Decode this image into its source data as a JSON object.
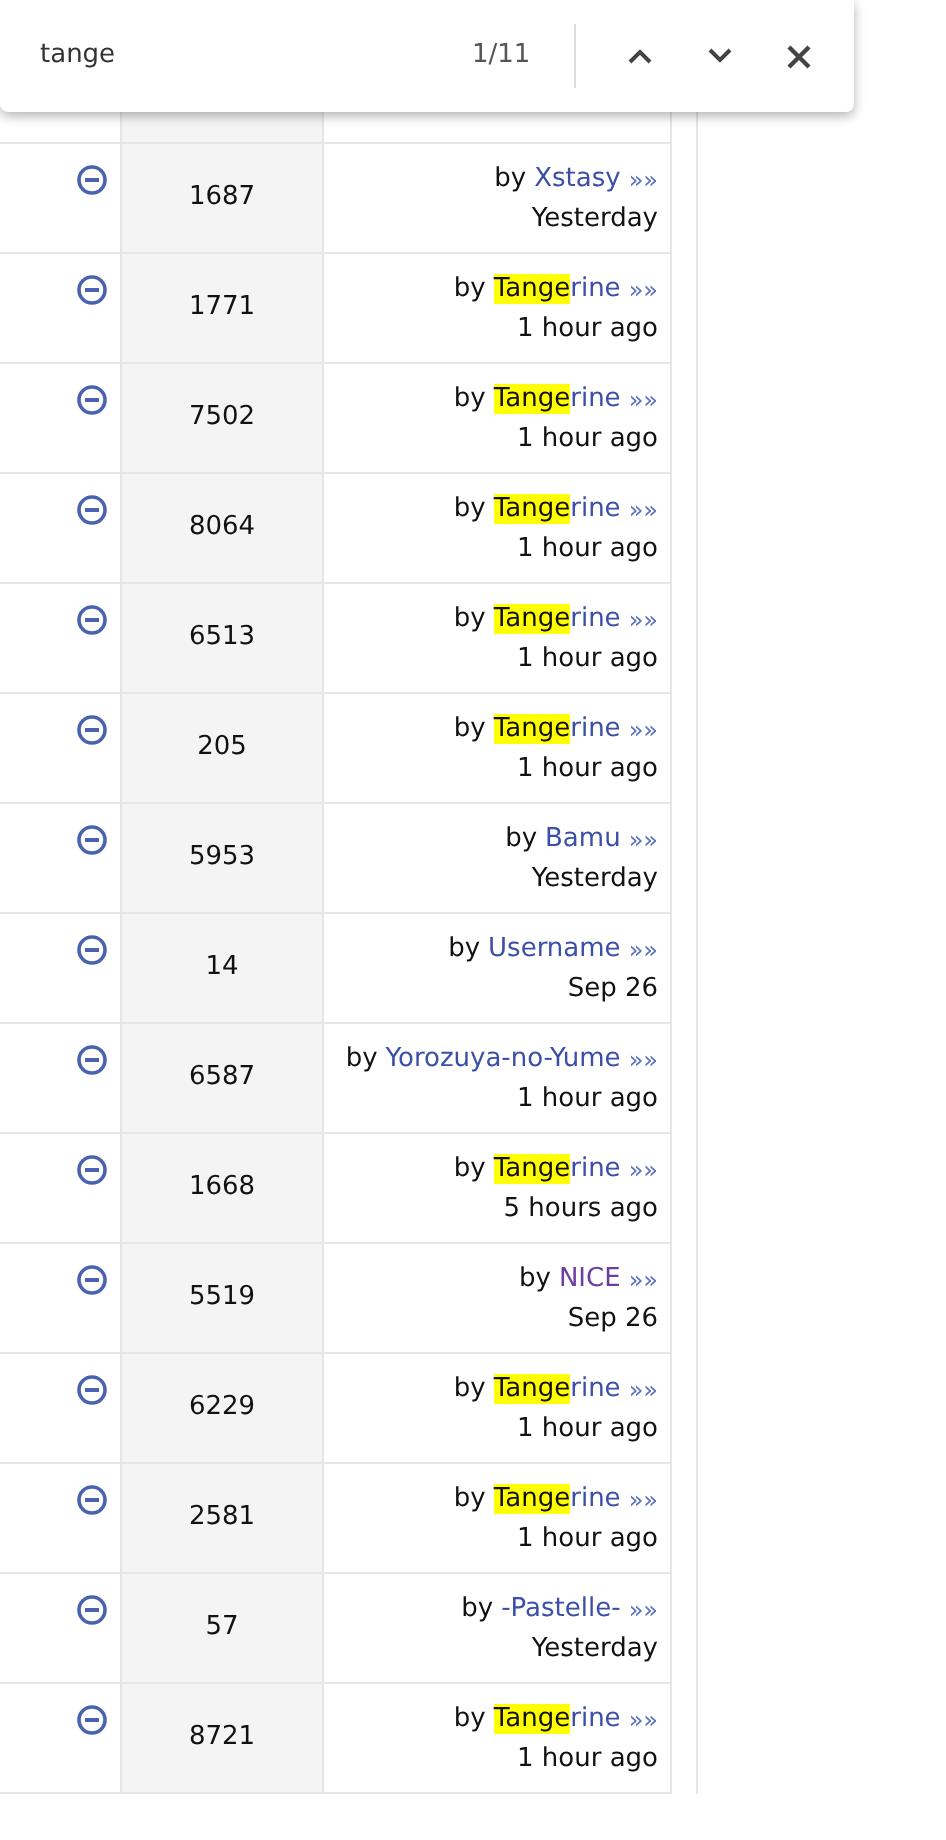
{
  "find_bar": {
    "query": "tange",
    "count": "1/11"
  },
  "rows": [
    {
      "count": "1687",
      "by": "by",
      "author": [
        {
          "text": "Xstasy",
          "highlighted": false
        }
      ],
      "visited": false,
      "more": "»»",
      "time": "Yesterday"
    },
    {
      "count": "1771",
      "by": "by",
      "author": [
        {
          "text": "Tange",
          "highlighted": true
        },
        {
          "text": "rine",
          "highlighted": false
        }
      ],
      "visited": false,
      "more": "»»",
      "time": "1 hour ago"
    },
    {
      "count": "7502",
      "by": "by",
      "author": [
        {
          "text": "Tange",
          "highlighted": true
        },
        {
          "text": "rine",
          "highlighted": false
        }
      ],
      "visited": false,
      "more": "»»",
      "time": "1 hour ago"
    },
    {
      "count": "8064",
      "by": "by",
      "author": [
        {
          "text": "Tange",
          "highlighted": true
        },
        {
          "text": "rine",
          "highlighted": false
        }
      ],
      "visited": false,
      "more": "»»",
      "time": "1 hour ago"
    },
    {
      "count": "6513",
      "by": "by",
      "author": [
        {
          "text": "Tange",
          "highlighted": true
        },
        {
          "text": "rine",
          "highlighted": false
        }
      ],
      "visited": false,
      "more": "»»",
      "time": "1 hour ago"
    },
    {
      "count": "205",
      "by": "by",
      "author": [
        {
          "text": "Tange",
          "highlighted": true
        },
        {
          "text": "rine",
          "highlighted": false
        }
      ],
      "visited": false,
      "more": "»»",
      "time": "1 hour ago"
    },
    {
      "count": "5953",
      "by": "by",
      "author": [
        {
          "text": "Bamu",
          "highlighted": false
        }
      ],
      "visited": false,
      "more": "»»",
      "time": "Yesterday"
    },
    {
      "count": "14",
      "by": "by",
      "author": [
        {
          "text": "Username",
          "highlighted": false
        }
      ],
      "visited": false,
      "more": "»»",
      "time": "Sep 26"
    },
    {
      "count": "6587",
      "by": "by",
      "author": [
        {
          "text": "Yorozuya-no-Yume",
          "highlighted": false
        }
      ],
      "visited": false,
      "more": "»»",
      "time": "1 hour ago"
    },
    {
      "count": "1668",
      "by": "by",
      "author": [
        {
          "text": "Tange",
          "highlighted": true
        },
        {
          "text": "rine",
          "highlighted": false
        }
      ],
      "visited": false,
      "more": "»»",
      "time": "5 hours ago"
    },
    {
      "count": "5519",
      "by": "by",
      "author": [
        {
          "text": "NICE",
          "highlighted": false
        }
      ],
      "visited": true,
      "more": "»»",
      "time": "Sep 26"
    },
    {
      "count": "6229",
      "by": "by",
      "author": [
        {
          "text": "Tange",
          "highlighted": true
        },
        {
          "text": "rine",
          "highlighted": false
        }
      ],
      "visited": false,
      "more": "»»",
      "time": "1 hour ago"
    },
    {
      "count": "2581",
      "by": "by",
      "author": [
        {
          "text": "Tange",
          "highlighted": true
        },
        {
          "text": "rine",
          "highlighted": false
        }
      ],
      "visited": false,
      "more": "»»",
      "time": "1 hour ago"
    },
    {
      "count": "57",
      "by": "by",
      "author": [
        {
          "text": "-Pastelle-",
          "highlighted": false
        }
      ],
      "visited": false,
      "more": "»»",
      "time": "Yesterday"
    },
    {
      "count": "8721",
      "by": "by",
      "author": [
        {
          "text": "Tange",
          "highlighted": true
        },
        {
          "text": "rine",
          "highlighted": false
        }
      ],
      "visited": false,
      "more": "»»",
      "time": "1 hour ago"
    }
  ]
}
